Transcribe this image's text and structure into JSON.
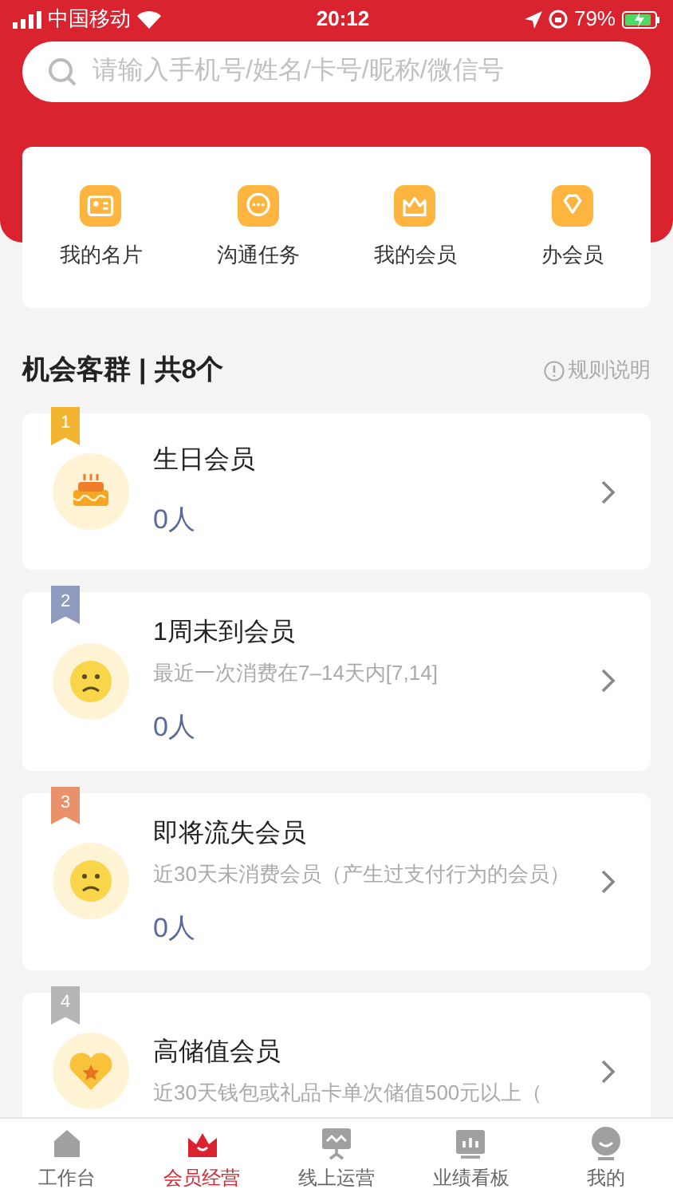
{
  "status_bar": {
    "carrier": "中国移动",
    "time": "20:12",
    "battery": "79%"
  },
  "search": {
    "placeholder": "请输入手机号/姓名/卡号/昵称/微信号"
  },
  "shortcuts": [
    {
      "label": "我的名片",
      "kind": "card"
    },
    {
      "label": "沟通任务",
      "kind": "chat"
    },
    {
      "label": "我的会员",
      "kind": "crown"
    },
    {
      "label": "办会员",
      "kind": "diamond"
    }
  ],
  "section": {
    "title": "机会客群",
    "separator": "|",
    "count": "共8个",
    "rules_link": "规则说明"
  },
  "groups": [
    {
      "rank": "1",
      "color": "#f3b52f",
      "kind": "cake",
      "title": "生日会员",
      "count": "0人"
    },
    {
      "rank": "2",
      "color": "#8e9bbf",
      "kind": "sad",
      "title": "1周未到会员",
      "description": "最近一次消费在7–14天内[7,14]",
      "count": "0人"
    },
    {
      "rank": "3",
      "color": "#e8916a",
      "kind": "sad",
      "title": "即将流失会员",
      "description": "近30天未消费会员（产生过支付行为的会员）",
      "count": "0人"
    },
    {
      "rank": "4",
      "color": "#b5b5b5",
      "kind": "heart",
      "title": "高储值会员",
      "description": "近30天钱包或礼品卡单次储值500元以上（"
    }
  ],
  "tab_bar": [
    {
      "label": "工作台",
      "kind": "home",
      "selected": false
    },
    {
      "label": "会员经营",
      "kind": "crown",
      "selected": true
    },
    {
      "label": "线上运营",
      "kind": "board",
      "selected": false
    },
    {
      "label": "业绩看板",
      "kind": "chart",
      "selected": false
    },
    {
      "label": "我的",
      "kind": "face",
      "selected": false
    }
  ]
}
